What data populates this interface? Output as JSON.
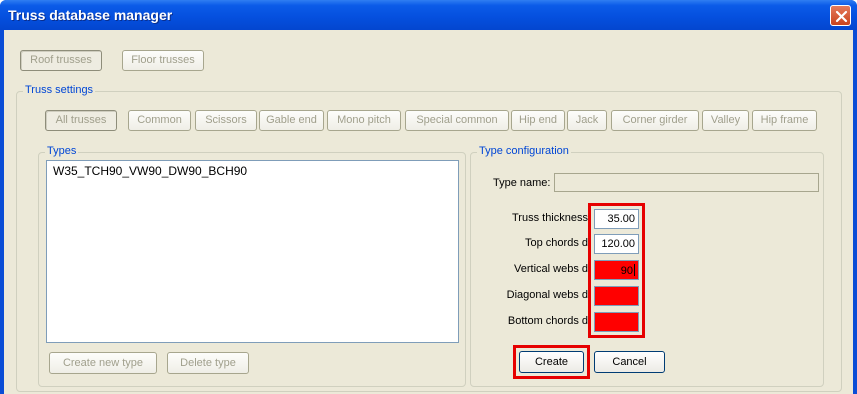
{
  "window": {
    "title": "Truss database manager",
    "close_icon": "close-icon"
  },
  "top_tabs": [
    {
      "label": "Roof trusses",
      "active": true
    },
    {
      "label": "Floor trusses",
      "active": false
    }
  ],
  "truss_settings": {
    "legend": "Truss settings",
    "filters": [
      {
        "label": "All trusses",
        "active": true
      },
      {
        "label": "Common"
      },
      {
        "label": "Scissors"
      },
      {
        "label": "Gable end"
      },
      {
        "label": "Mono pitch"
      },
      {
        "label": "Special common"
      },
      {
        "label": "Hip end"
      },
      {
        "label": "Jack"
      },
      {
        "label": "Corner girder"
      },
      {
        "label": "Valley"
      },
      {
        "label": "Hip frame"
      }
    ]
  },
  "types": {
    "legend": "Types",
    "items": [
      "W35_TCH90_VW90_DW90_BCH90"
    ],
    "create_new_label": "Create new type",
    "delete_label": "Delete type"
  },
  "type_config": {
    "legend": "Type configuration",
    "type_name_label": "Type name:",
    "type_name_value": "",
    "fields": [
      {
        "label": "Truss thickness",
        "value": "35.00",
        "state": "normal"
      },
      {
        "label": "Top chords d",
        "value": "120.00",
        "state": "normal"
      },
      {
        "label": "Vertical webs d",
        "value": "90",
        "state": "error"
      },
      {
        "label": "Diagonal webs d",
        "value": "",
        "state": "error"
      },
      {
        "label": "Bottom chords d",
        "value": "",
        "state": "error"
      }
    ],
    "create_label": "Create",
    "cancel_label": "Cancel"
  },
  "colors": {
    "error_fill": "#ff0000",
    "highlight": "#e60000",
    "titlebar": "#0550df",
    "legend_text": "#0046d5"
  }
}
